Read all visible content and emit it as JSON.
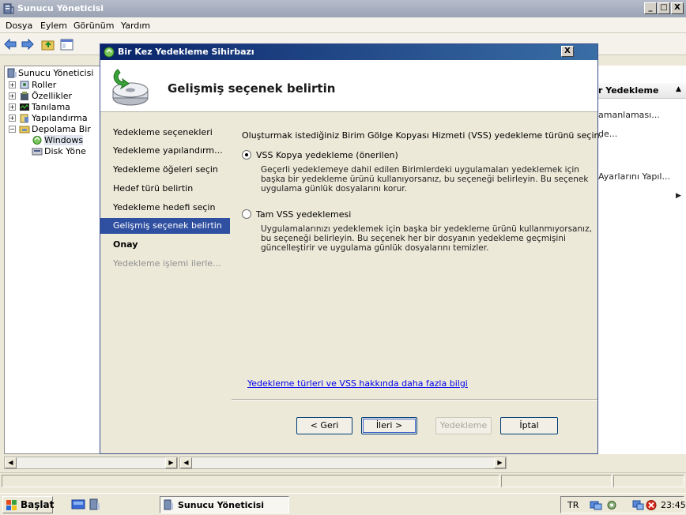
{
  "main_window": {
    "title": "Sunucu Yöneticisi",
    "caption_buttons": [
      "_",
      "□",
      "X"
    ]
  },
  "menu": [
    "Dosya",
    "Eylem",
    "Görünüm",
    "Yardım"
  ],
  "tree": {
    "items": [
      {
        "label": "Sunucu Yöneticisi",
        "icon": "server-icon"
      },
      {
        "label": "Roller",
        "icon": "roles-icon"
      },
      {
        "label": "Özellikler",
        "icon": "features-icon"
      },
      {
        "label": "Tanılama",
        "icon": "diagnostics-icon"
      },
      {
        "label": "Yapılandırma",
        "icon": "configuration-icon"
      },
      {
        "label": "Depolama Bir",
        "icon": "storage-icon"
      },
      {
        "label": "Windows",
        "icon": "backup-icon"
      },
      {
        "label": "Disk Yöne",
        "icon": "disk-icon"
      }
    ]
  },
  "actions_pane": {
    "header": "r Yedekleme",
    "items": [
      "amanlaması...",
      "de...",
      "Ayarlarını Yapıl..."
    ]
  },
  "wizard": {
    "title": "Bir Kez Yedekleme Sihirbazı",
    "close": "X",
    "heading": "Gelişmiş seçenek belirtin",
    "steps": [
      {
        "label": "Yedekleme seçenekleri",
        "state": "done"
      },
      {
        "label": "Yedekleme yapılandırm...",
        "state": "done"
      },
      {
        "label": "Yedekleme öğeleri seçin",
        "state": "done"
      },
      {
        "label": "Hedef türü belirtin",
        "state": "done"
      },
      {
        "label": "Yedekleme hedefi seçin",
        "state": "done"
      },
      {
        "label": "Gelişmiş seçenek belirtin",
        "state": "active"
      },
      {
        "label": "Onay",
        "state": "next"
      },
      {
        "label": "Yedekleme işlemi ilerle...",
        "state": "pending"
      }
    ],
    "intro": "Oluşturmak istediğiniz Birim Gölge Kopyası Hizmeti (VSS) yedekleme türünü seçin.",
    "options": [
      {
        "label": "VSS Kopya yedekleme (önerilen)",
        "selected": true,
        "description": "Geçerli yedeklemeye dahil edilen Birimlerdeki uygulamaları yedeklemek için başka bir yedekleme ürünü kullanıyorsanız, bu seçeneği belirleyin. Bu seçenek uygulama günlük dosyalarını korur."
      },
      {
        "label": "Tam VSS yedeklemesi",
        "selected": false,
        "description": "Uygulamalarınızı yedeklemek için başka bir yedekleme ürünü kullanmıyorsanız, bu seçeneği belirleyin. Bu seçenek her bir dosyanın yedekleme geçmişini güncelleştirir ve uygulama günlük dosyalarını temizler."
      }
    ],
    "help_link": "Yedekleme türleri ve VSS hakkında daha fazla bilgi",
    "buttons": {
      "back": "< Geri",
      "next": "İleri >",
      "backup": "Yedekleme",
      "cancel": "İptal"
    }
  },
  "taskbar": {
    "start": "Başlat",
    "task": "Sunucu Yöneticisi",
    "lang": "TR",
    "clock": "23:45"
  }
}
